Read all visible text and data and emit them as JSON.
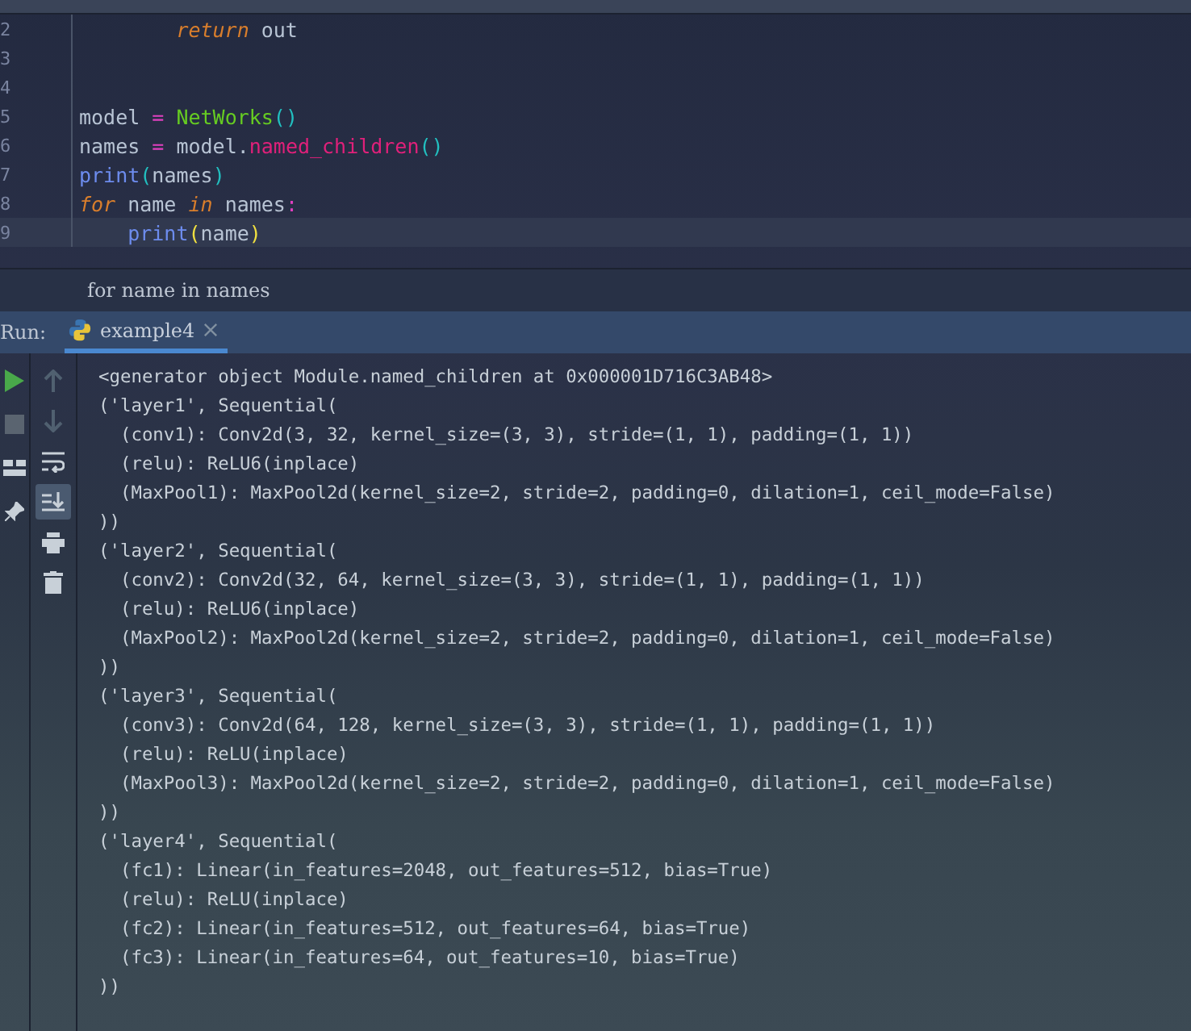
{
  "editor": {
    "lines": [
      {
        "number": "2",
        "tokens": [
          {
            "kind": "keyword",
            "text": "        return"
          },
          {
            "kind": "plain",
            "text": " out"
          }
        ]
      },
      {
        "number": "3"
      },
      {
        "number": "4"
      },
      {
        "number": "5",
        "tokens": [
          {
            "kind": "plain",
            "text": "model "
          },
          {
            "kind": "op",
            "text": "="
          },
          {
            "kind": "class",
            "text": " NetWorks"
          },
          {
            "kind": "paren",
            "text": "()"
          }
        ]
      },
      {
        "number": "6",
        "tokens": [
          {
            "kind": "plain",
            "text": "names "
          },
          {
            "kind": "op",
            "text": "="
          },
          {
            "kind": "plain",
            "text": " model."
          },
          {
            "kind": "method",
            "text": "named_children"
          },
          {
            "kind": "paren",
            "text": "()"
          }
        ]
      },
      {
        "number": "7",
        "tokens": [
          {
            "kind": "builtin",
            "text": "print"
          },
          {
            "kind": "paren",
            "text": "("
          },
          {
            "kind": "plain",
            "text": "names"
          },
          {
            "kind": "paren",
            "text": ")"
          }
        ]
      },
      {
        "number": "8",
        "tokens": [
          {
            "kind": "keyword",
            "text": "for"
          },
          {
            "kind": "plain",
            "text": " name "
          },
          {
            "kind": "keyword",
            "text": "in"
          },
          {
            "kind": "plain",
            "text": " names"
          },
          {
            "kind": "op",
            "text": ":"
          }
        ]
      },
      {
        "number": "9",
        "current": true,
        "tokens": [
          {
            "kind": "builtin",
            "text": "    print"
          },
          {
            "kind": "bracket",
            "text": "("
          },
          {
            "kind": "plain",
            "text": "name"
          },
          {
            "kind": "bracket",
            "text": ")"
          }
        ]
      }
    ]
  },
  "breadcrumb": "for name in names",
  "run_panel": {
    "label": "Run:",
    "tabs": [
      {
        "label": "example4",
        "selected": true
      }
    ],
    "toolbar_left": [
      {
        "kind": "run"
      },
      {
        "kind": "stop"
      },
      {
        "kind": "layout"
      },
      {
        "kind": "pin"
      }
    ],
    "toolbar_right": [
      {
        "kind": "up",
        "disabled": true,
        "on": false
      },
      {
        "kind": "down",
        "disabled": true,
        "on": false
      },
      {
        "kind": "wrap",
        "disabled": false,
        "on": false
      },
      {
        "kind": "scroll",
        "disabled": false,
        "on": true
      },
      {
        "kind": "print",
        "disabled": false,
        "on": false
      },
      {
        "kind": "trash",
        "disabled": false,
        "on": false
      }
    ],
    "output": [
      "<generator object Module.named_children at 0x000001D716C3AB48>",
      "('layer1', Sequential(",
      "  (conv1): Conv2d(3, 32, kernel_size=(3, 3), stride=(1, 1), padding=(1, 1))",
      "  (relu): ReLU6(inplace)",
      "  (MaxPool1): MaxPool2d(kernel_size=2, stride=2, padding=0, dilation=1, ceil_mode=False)",
      "))",
      "('layer2', Sequential(",
      "  (conv2): Conv2d(32, 64, kernel_size=(3, 3), stride=(1, 1), padding=(1, 1))",
      "  (relu): ReLU6(inplace)",
      "  (MaxPool2): MaxPool2d(kernel_size=2, stride=2, padding=0, dilation=1, ceil_mode=False)",
      "))",
      "('layer3', Sequential(",
      "  (conv3): Conv2d(64, 128, kernel_size=(3, 3), stride=(1, 1), padding=(1, 1))",
      "  (relu): ReLU(inplace)",
      "  (MaxPool3): MaxPool2d(kernel_size=2, stride=2, padding=0, dilation=1, ceil_mode=False)",
      "))",
      "('layer4', Sequential(",
      "  (fc1): Linear(in_features=2048, out_features=512, bias=True)",
      "  (relu): ReLU(inplace)",
      "  (fc2): Linear(in_features=512, out_features=64, bias=True)",
      "  (fc3): Linear(in_features=64, out_features=10, bias=True)",
      "))"
    ]
  }
}
